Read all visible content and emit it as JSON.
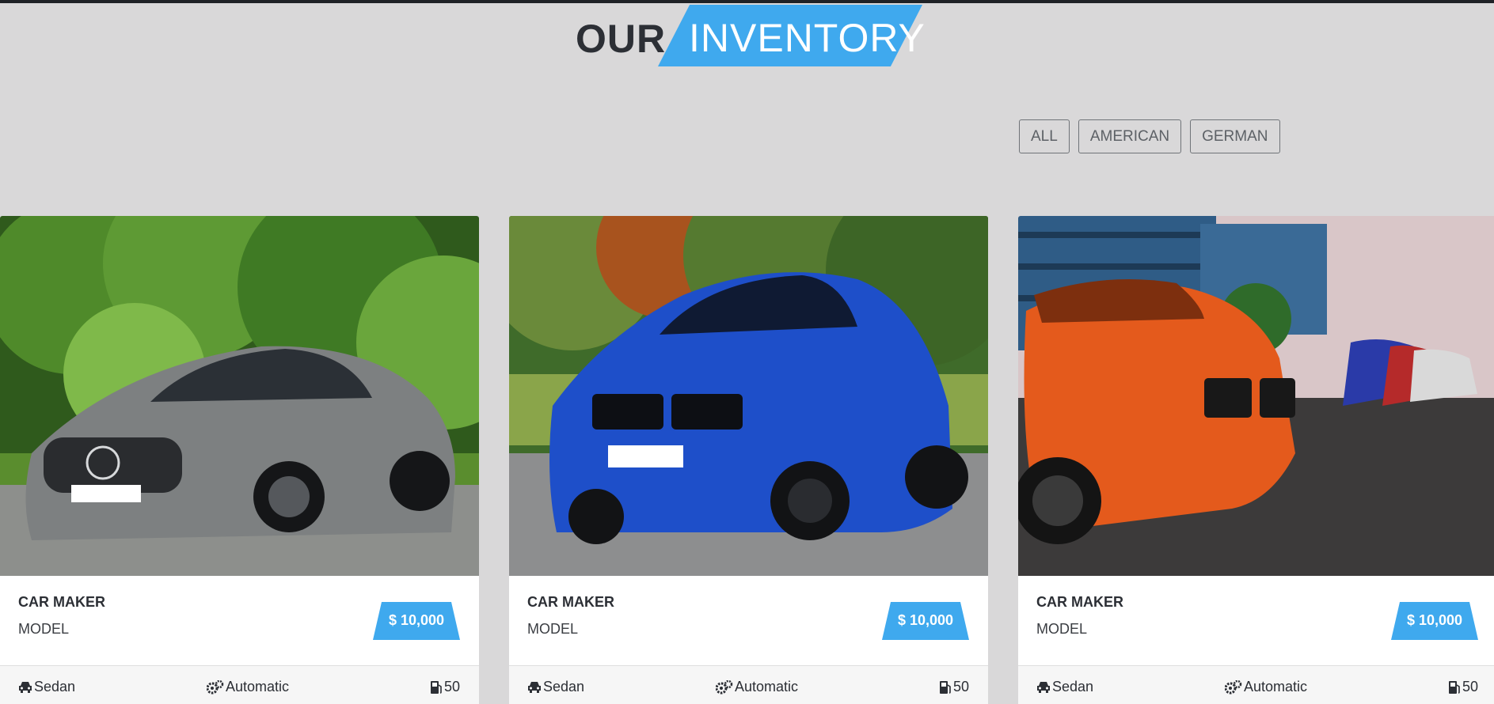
{
  "header": {
    "title_dark": "OUR",
    "title_highlight": "INVENTORY"
  },
  "filters": [
    {
      "label": "ALL"
    },
    {
      "label": "AMERICAN"
    },
    {
      "label": "GERMAN"
    }
  ],
  "cars": [
    {
      "maker": "CAR MAKER",
      "model": "MODEL",
      "price": "$ 10,000",
      "body_type": "Sedan",
      "transmission": "Automatic",
      "fuel": "50"
    },
    {
      "maker": "CAR MAKER",
      "model": "MODEL",
      "price": "$ 10,000",
      "body_type": "Sedan",
      "transmission": "Automatic",
      "fuel": "50"
    },
    {
      "maker": "CAR MAKER",
      "model": "MODEL",
      "price": "$ 10,000",
      "body_type": "Sedan",
      "transmission": "Automatic",
      "fuel": "50"
    }
  ],
  "icons": {
    "body_type": "car-icon",
    "transmission": "gears-icon",
    "fuel": "gas-pump-icon"
  },
  "colors": {
    "accent": "#3fa9ee",
    "background": "#d9d8d9",
    "text": "#2c2f35"
  }
}
